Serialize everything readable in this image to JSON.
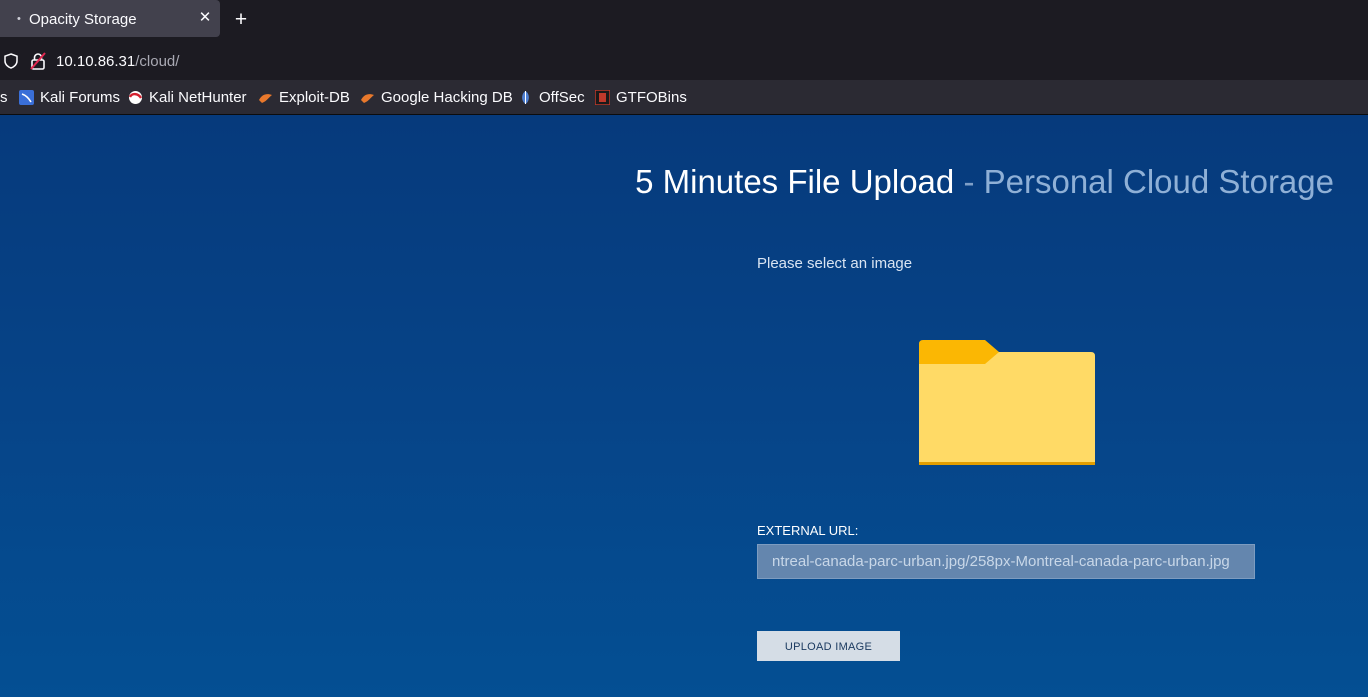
{
  "browser": {
    "tab": {
      "title": "Opacity Storage",
      "dot": "•",
      "close_glyph": "✕"
    },
    "new_tab_glyph": "+",
    "url": {
      "host": "10.10.86.31",
      "path": "/cloud/"
    },
    "bookmarks": [
      {
        "label": "s",
        "icon": "partial-bookmark"
      },
      {
        "label": "Kali Forums",
        "icon": "kali-forums-icon"
      },
      {
        "label": "Kali NetHunter",
        "icon": "kali-nethunter-icon"
      },
      {
        "label": "Exploit-DB",
        "icon": "exploit-db-icon"
      },
      {
        "label": "Google Hacking DB",
        "icon": "google-hacking-db-icon"
      },
      {
        "label": "OffSec",
        "icon": "offsec-icon"
      },
      {
        "label": "GTFOBins",
        "icon": "gtfobins-icon"
      }
    ]
  },
  "page": {
    "heading_main": "5 Minutes File Upload",
    "heading_sep": "-",
    "heading_sub": "Personal Cloud Storage",
    "prompt": "Please select an image",
    "external_url_label": "EXTERNAL URL:",
    "external_url_value": "ntreal-canada-parc-urban.jpg/258px-Montreal-canada-parc-urban.jpg",
    "upload_button": "UPLOAD IMAGE"
  },
  "colors": {
    "page_bg_top": "#063a7c",
    "page_bg_bottom": "#044f93",
    "folder_back": "#fbb703",
    "folder_front": "#ffda66"
  }
}
